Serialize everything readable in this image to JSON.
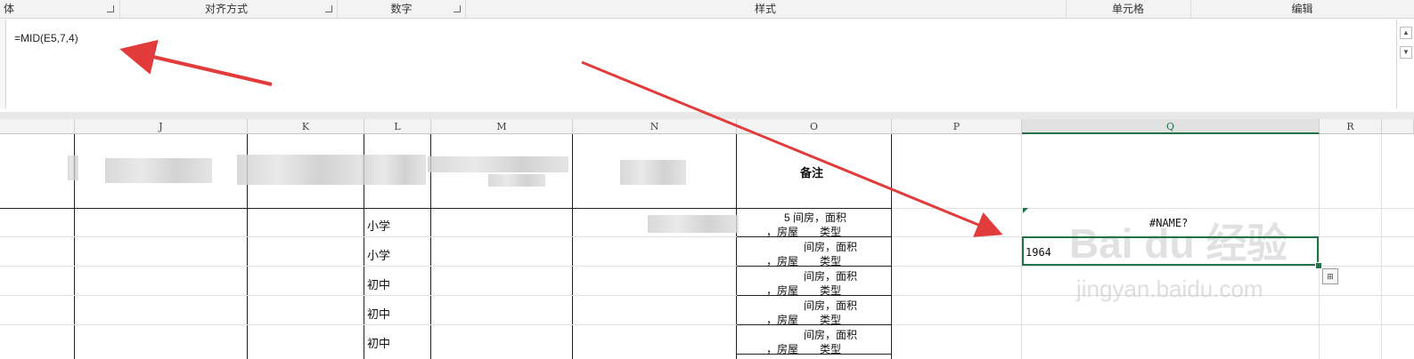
{
  "ribbon": {
    "groups": [
      "体",
      "对齐方式",
      "数字",
      "样式",
      "单元格",
      "编辑"
    ]
  },
  "formula_bar": {
    "formula": "=MID(E5,7,4)",
    "scroll_up_icon": "scroll-up-icon",
    "scroll_down_icon": "scroll-down-icon"
  },
  "columns": [
    "J",
    "K",
    "L",
    "M",
    "N",
    "O",
    "P",
    "Q",
    "R"
  ],
  "selected_column": "Q",
  "header_row": {
    "O_label": "备注"
  },
  "rows": [
    {
      "L": "小学",
      "O_line1": "5 间房，面积",
      "O_line2": "，房屋　　类型",
      "Q": "#NAME?"
    },
    {
      "L": "小学",
      "O_line1": "间房，面积",
      "O_line2": "，房屋　　类型",
      "Q": "1964"
    },
    {
      "L": "初中",
      "O_line1": "间房，面积",
      "O_line2": "，房屋　　类型",
      "Q": ""
    },
    {
      "L": "初中",
      "O_line1": "间房，面积",
      "O_line2": "，房屋　　类型",
      "Q": ""
    },
    {
      "L": "初中",
      "O_line1": "间房，面积",
      "O_line2": "，房屋　　类型",
      "Q": ""
    }
  ],
  "watermark": {
    "brand": "Bai du 经验",
    "url": "jingyan.baidu.com"
  },
  "colors": {
    "accent": "#217346",
    "arrow": "#e23b3b"
  },
  "icons": {
    "quick_analysis": "quick-analysis-icon",
    "fill_handle": "fill-handle-icon"
  }
}
